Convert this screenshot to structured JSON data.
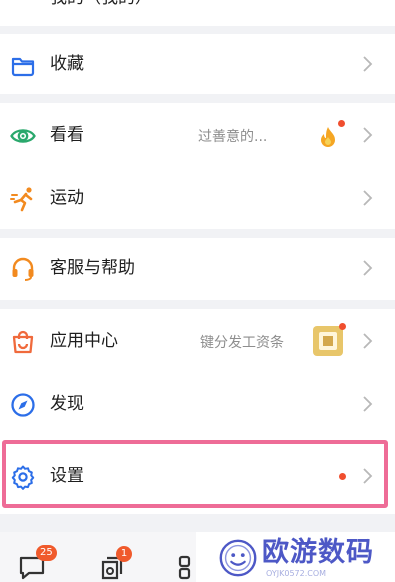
{
  "top_partial_label": "我的（我的）",
  "menu": {
    "favorites": {
      "label": "收藏",
      "icon": "folder-icon"
    },
    "watch": {
      "label": "看看",
      "subtitle": "过善意的...",
      "icon": "eye-icon"
    },
    "sport": {
      "label": "运动",
      "icon": "running-icon"
    },
    "support": {
      "label": "客服与帮助",
      "icon": "headset-icon"
    },
    "apps": {
      "label": "应用中心",
      "subtitle": "键分发工资条",
      "icon": "shopping-bag-icon"
    },
    "discover": {
      "label": "发现",
      "icon": "compass-icon"
    },
    "settings": {
      "label": "设置",
      "icon": "gear-icon"
    }
  },
  "tabbar": {
    "messages_badge": "25",
    "docs_badge": "1"
  },
  "watermark": {
    "text": "欧游数码",
    "sub": "OYJK0572.COM"
  },
  "colors": {
    "accent_blue": "#2c6ee8",
    "accent_orange": "#f28a1f",
    "accent_green": "#2aa86c",
    "highlight_pink": "#ee6c97",
    "badge_red": "#f04e2e"
  }
}
